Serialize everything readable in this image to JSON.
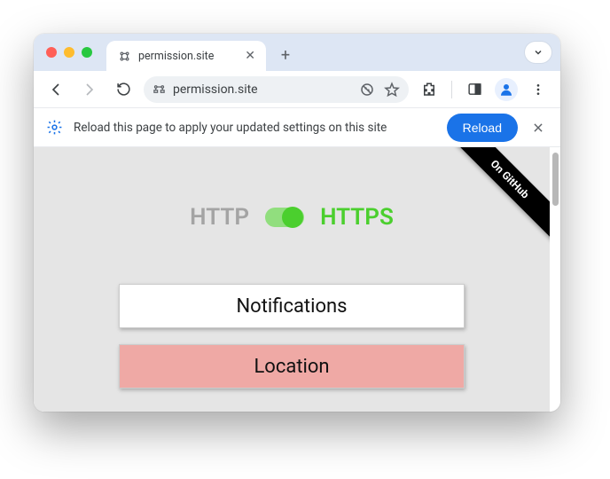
{
  "tab": {
    "title": "permission.site"
  },
  "omnibox": {
    "url": "permission.site"
  },
  "infobar": {
    "message": "Reload this page to apply your updated settings on this site",
    "button": "Reload"
  },
  "ribbon": {
    "label": "On GitHub"
  },
  "protocol": {
    "http": "HTTP",
    "https": "HTTPS",
    "active": "https"
  },
  "buttons": {
    "notifications": "Notifications",
    "location": "Location"
  }
}
